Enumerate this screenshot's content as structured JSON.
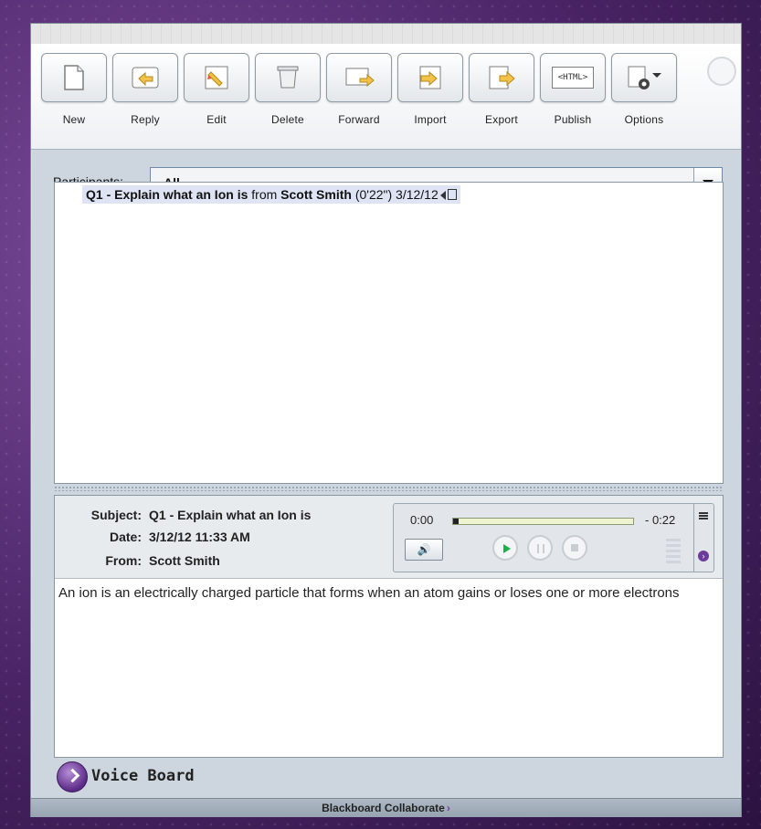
{
  "toolbar": {
    "buttons": [
      {
        "label": "New",
        "icon": "new-document-icon"
      },
      {
        "label": "Reply",
        "icon": "reply-icon"
      },
      {
        "label": "Edit",
        "icon": "edit-icon"
      },
      {
        "label": "Delete",
        "icon": "delete-icon"
      },
      {
        "label": "Forward",
        "icon": "forward-icon"
      },
      {
        "label": "Import",
        "icon": "import-icon"
      },
      {
        "label": "Export",
        "icon": "export-icon"
      },
      {
        "label": "Publish",
        "icon": "html-icon",
        "icon_text": "<HTML>"
      },
      {
        "label": "Options",
        "icon": "options-icon"
      }
    ]
  },
  "participants": {
    "label": "Participants:",
    "selected": "All"
  },
  "messages": [
    {
      "subject_bold": "Q1 - Explain what an Ion is",
      "from_word": "from",
      "author_bold": "Scott Smith",
      "duration": "(0'22\")",
      "date": "3/12/12"
    }
  ],
  "detail": {
    "labels": {
      "subject": "Subject:",
      "date": "Date:",
      "from": "From:"
    },
    "subject": "Q1 - Explain what an Ion is",
    "date": "3/12/12 11:33 AM",
    "from": "Scott Smith",
    "body": "An ion is an electrically charged particle that forms when an atom gains or loses one or more electrons"
  },
  "player": {
    "time_current": "0:00",
    "time_remaining": "- 0:22",
    "progress": 0.03
  },
  "app": {
    "name": "Voice Board",
    "footer": "Blackboard Collaborate"
  },
  "colors": {
    "accent_purple": "#6b3a9a",
    "play_green": "#18b24a",
    "selection": "#dfe4f4"
  }
}
